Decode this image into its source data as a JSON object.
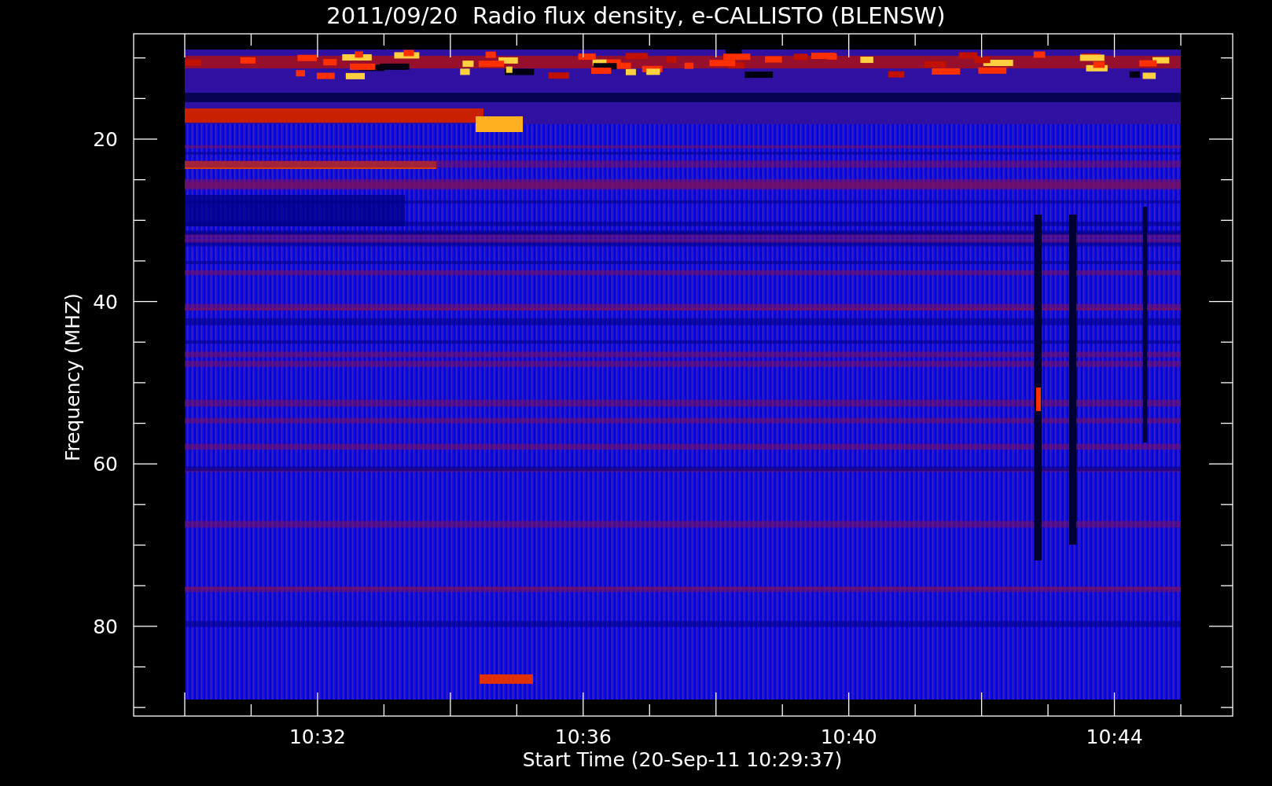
{
  "title": "2011/09/20  Radio flux density, e-CALLISTO (BLENSW)",
  "y_axis": {
    "label": "Frequency (MHZ)",
    "ticks": [
      "20",
      "40",
      "60",
      "80"
    ]
  },
  "x_axis": {
    "label": "Start Time (20-Sep-11 10:29:37)",
    "ticks": [
      "10:32",
      "10:36",
      "10:40",
      "10:44"
    ]
  }
}
